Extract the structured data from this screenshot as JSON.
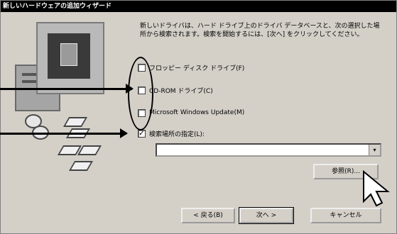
{
  "window": {
    "title": "新しいハードウェアの追加ウィザード"
  },
  "description": "新しいドライバは、ハード ドライブ上のドライバ データベースと、次の選択した場所から検索されます。検索を開始するには、[次へ] をクリックしてください。",
  "options": [
    {
      "label": "フロッピー ディスク ドライブ(F)",
      "checked": false
    },
    {
      "label": "CD-ROM ドライブ(C)",
      "checked": false
    },
    {
      "label": "Microsoft Windows Update(M)",
      "checked": false
    },
    {
      "label": "検索場所の指定(L):",
      "checked": true,
      "mark": "✓"
    }
  ],
  "path_combo": {
    "value": ""
  },
  "buttons": {
    "browse": "参照(R)...",
    "back": "< 戻る(B)",
    "next": "次へ >",
    "cancel": "キャンセル"
  },
  "icons": {
    "combo_arrow": "▾"
  }
}
